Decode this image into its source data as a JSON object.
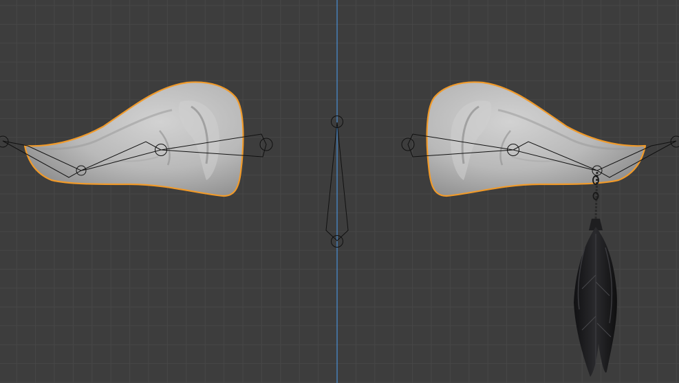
{
  "app": "Blender",
  "viewport": {
    "view": "front-orthographic",
    "colors": {
      "background": "#3d3d3d",
      "grid_line": "#474747",
      "z_axis": "#4a8fd6",
      "selection_outline": "#f09a2a",
      "mesh_fill": "#bdbdbd",
      "bone_wire": "#111111",
      "earring": "#1c1c1e"
    },
    "objects": [
      {
        "name": "left-ear-mesh",
        "selected": true
      },
      {
        "name": "right-ear-mesh",
        "selected": true
      },
      {
        "name": "feather-earring",
        "selected": false
      },
      {
        "name": "left-ear-armature",
        "bones": 3
      },
      {
        "name": "right-ear-armature",
        "bones": 3
      },
      {
        "name": "center-bone",
        "bones": 1
      }
    ]
  }
}
